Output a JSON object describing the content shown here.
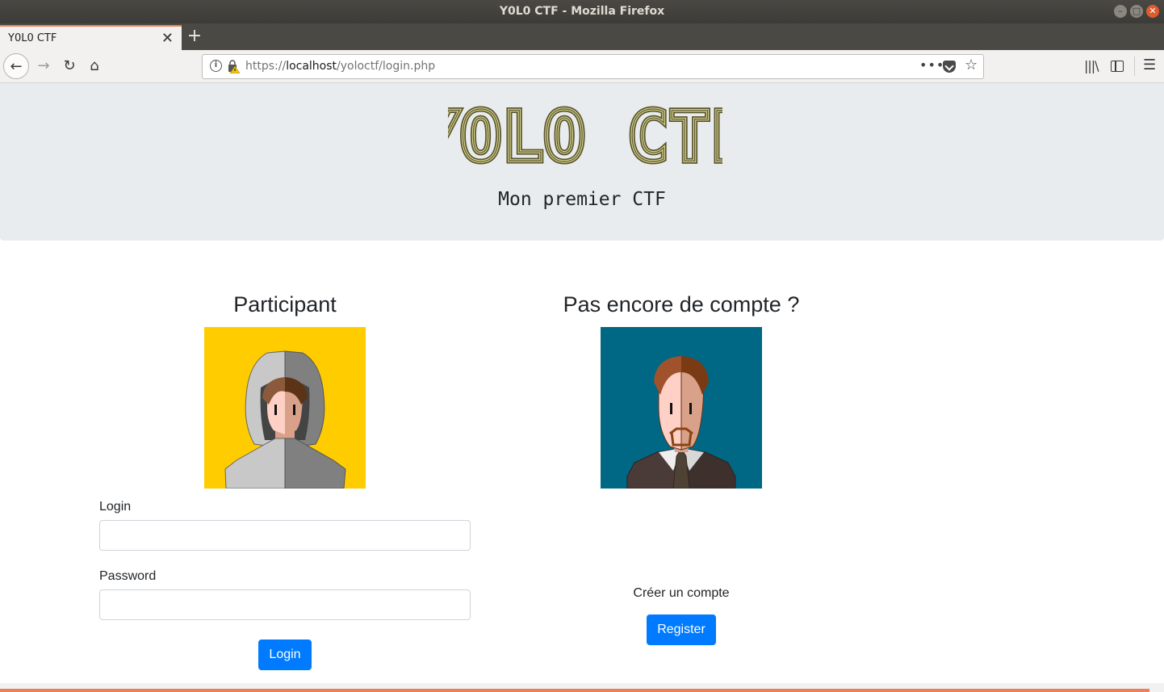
{
  "window": {
    "title": "Y0L0 CTF - Mozilla Firefox"
  },
  "tabs": [
    {
      "label": "Y0L0 CTF",
      "active": true
    }
  ],
  "urlbar": {
    "scheme": "https://",
    "host": "localhost",
    "path": "/yoloctf/login.php"
  },
  "site": {
    "logo_text": "YOLO CTF",
    "subtitle": "Mon premier CTF"
  },
  "login_panel": {
    "title": "Participant",
    "login_label": "Login",
    "login_value": "",
    "password_label": "Password",
    "password_value": "",
    "submit_label": "Login"
  },
  "register_panel": {
    "title": "Pas encore de compte ?",
    "text": "Créer un compte",
    "button_label": "Register"
  },
  "colors": {
    "primary": "#007bff",
    "jumbotron_bg": "#e9ecef",
    "logo_stroke": "#5a5630",
    "avatar_left_bg": "#ffcc00",
    "avatar_right_bg": "#006884",
    "firefox_accent": "#e9825a"
  },
  "icons": [
    "back-icon",
    "forward-icon",
    "reload-icon",
    "home-icon",
    "info-icon",
    "insecure-lock-icon",
    "page-actions-icon",
    "pocket-icon",
    "bookmark-star-icon",
    "library-icon",
    "sidebar-icon",
    "hamburger-menu-icon"
  ]
}
